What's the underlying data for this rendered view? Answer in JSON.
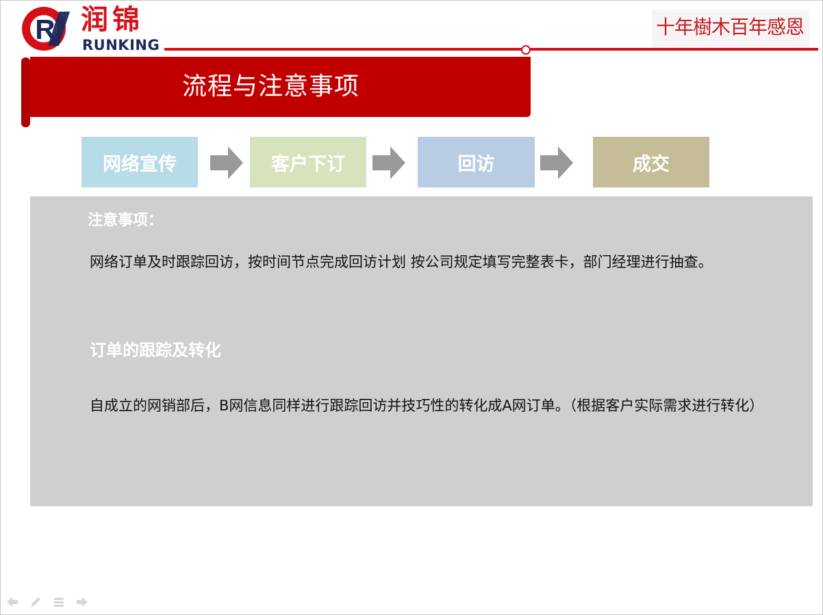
{
  "logo": {
    "chinese": "润锦",
    "english": "RUNKING"
  },
  "slogan": "十年樹木百年感恩",
  "title": "流程与注意事项",
  "steps": [
    "网络宣传",
    "客户下订",
    "回访",
    "成交"
  ],
  "colors": {
    "brand_red": "#d40f16",
    "banner_red": "#c00000",
    "step_1": "#b8dbe8",
    "step_2": "#d7e3bc",
    "step_3": "#b8cce4",
    "step_4": "#c4bd97",
    "arrow": "#999999",
    "panel": "#cfcfcf"
  },
  "notes": {
    "heading": "注意事项：",
    "text1": "网络订单及时跟踪回访，按时间节点完成回访计划  按公司规定填写完整表卡，部门经理进行抽查。",
    "subheading": "订单的跟踪及转化",
    "text2": "自成立的网销部后，B网信息同样进行跟踪回访并技巧性的转化成A网订单。（根据客户实际需求进行转化）"
  },
  "controls": {
    "prev_icon": "arrow-left-icon",
    "pen_icon": "pen-icon",
    "menu_icon": "menu-icon",
    "next_icon": "arrow-right-icon"
  }
}
